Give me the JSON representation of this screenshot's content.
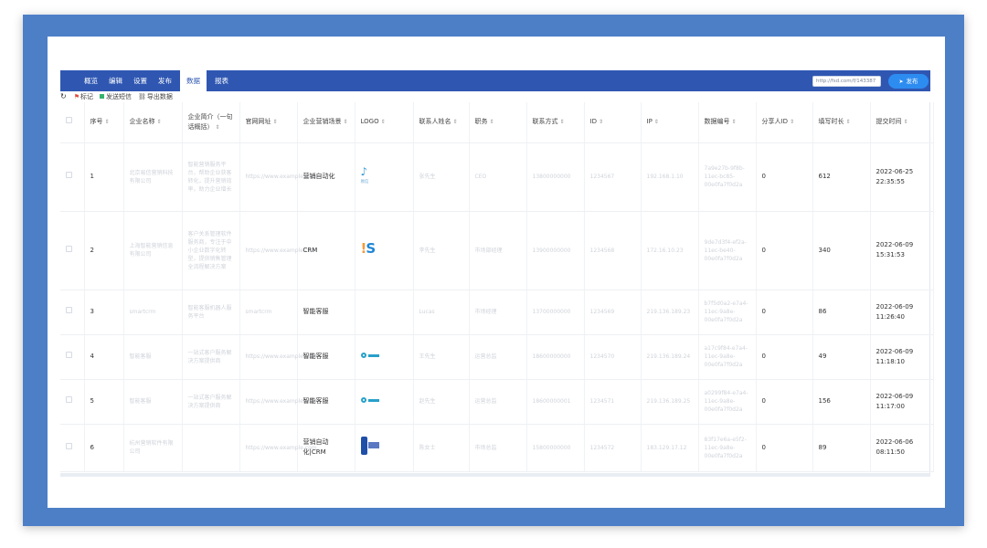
{
  "nav": {
    "tabs": [
      "概览",
      "编辑",
      "设置",
      "发布",
      "数据",
      "报表"
    ],
    "active_tab": "数据",
    "url": "http://fsd.com/f/143387",
    "publish_label": "发布"
  },
  "toolbar": {
    "mark_label": "标记",
    "sms_label": "发送短信",
    "export_label": "导出数据"
  },
  "table": {
    "headers": [
      "序号",
      "企业名称",
      "企业简介（一句话概括）",
      "官网网址",
      "企业营销场景",
      "LOGO",
      "联系人姓名",
      "职务",
      "联系方式",
      "ID",
      "IP",
      "数据编号",
      "分享人ID",
      "填写时长",
      "提交时间"
    ],
    "rows": [
      {
        "no": "1",
        "company": "北京易信营销科技有限公司",
        "intro": "智能营销服务平台，帮助企业获客转化，提升营销效率，助力企业增长",
        "website": "https://www.example.com",
        "scene": "营销自动化",
        "logo": "bird",
        "contact": "张先生",
        "title": "CEO",
        "phone": "13800000000",
        "id": "1234567",
        "ip": "192.168.1.10",
        "data_no": "7a9e27b-9f8b-11ec-bc85-00e0fa7f0d2a",
        "sharer": "0",
        "duration": "612",
        "submit_time": "2022-06-25 22:35:55"
      },
      {
        "no": "2",
        "company": "上海智能营销信息有限公司",
        "intro": "客户关系管理软件服务商，专注于中小企业数字化转型，提供销售管理全流程解决方案",
        "website": "https://www.example.com",
        "scene": "CRM",
        "logo": "is",
        "contact": "李先生",
        "title": "市场部经理",
        "phone": "13900000000",
        "id": "1234568",
        "ip": "172.16.10.23",
        "data_no": "9de7d3f4-ef2a-11ec-be40-00e0fa7f0d2a",
        "sharer": "0",
        "duration": "340",
        "submit_time": "2022-06-09 15:31:53"
      },
      {
        "no": "3",
        "company": "smartcrm",
        "intro": "智能客服机器人服务平台",
        "website": "smartcrm",
        "scene": "智能客服",
        "logo": "",
        "contact": "Lucas",
        "title": "市场经理",
        "phone": "13700000000",
        "id": "1234569",
        "ip": "219.136.189.23",
        "data_no": "b7f5d0a2-e7a4-11ec-9a8e-00e0fa7f0d2a",
        "sharer": "0",
        "duration": "86",
        "submit_time": "2022-06-09 11:26:40"
      },
      {
        "no": "4",
        "company": "智能客服",
        "intro": "一站式客户服务解决方案提供商",
        "website": "https://www.example.com",
        "scene": "智能客服",
        "logo": "small",
        "contact": "王先生",
        "title": "运营总监",
        "phone": "18600000000",
        "id": "1234570",
        "ip": "219.136.189.24",
        "data_no": "a17c9f84-e7a4-11ec-9a8e-00e0fa7f0d2a",
        "sharer": "0",
        "duration": "49",
        "submit_time": "2022-06-09 11:18:10"
      },
      {
        "no": "5",
        "company": "智能客服",
        "intro": "一站式客户服务解决方案提供商",
        "website": "https://www.example.com",
        "scene": "智能客服",
        "logo": "small",
        "contact": "赵先生",
        "title": "运营总监",
        "phone": "18600000001",
        "id": "1234571",
        "ip": "219.136.189.25",
        "data_no": "a0299f84-e7a4-11ec-9a8e-00e0fa7f0d2a",
        "sharer": "0",
        "duration": "156",
        "submit_time": "2022-06-09 11:17:00"
      },
      {
        "no": "6",
        "company": "杭州营销软件有限公司",
        "intro": "",
        "website": "https://www.example.com",
        "scene": "营销自动化|CRM",
        "logo": "blue",
        "contact": "陈女士",
        "title": "市场总监",
        "phone": "15800000000",
        "id": "1234572",
        "ip": "183.129.17.12",
        "data_no": "83f17e6a-e5f2-11ec-9a8e-00e0fa7f0d2a",
        "sharer": "0",
        "duration": "89",
        "submit_time": "2022-06-06 08:11:50"
      }
    ]
  },
  "colors": {
    "frame": "#4d7fc7",
    "nav": "#2f57b2",
    "publish": "#2d8cf0"
  }
}
